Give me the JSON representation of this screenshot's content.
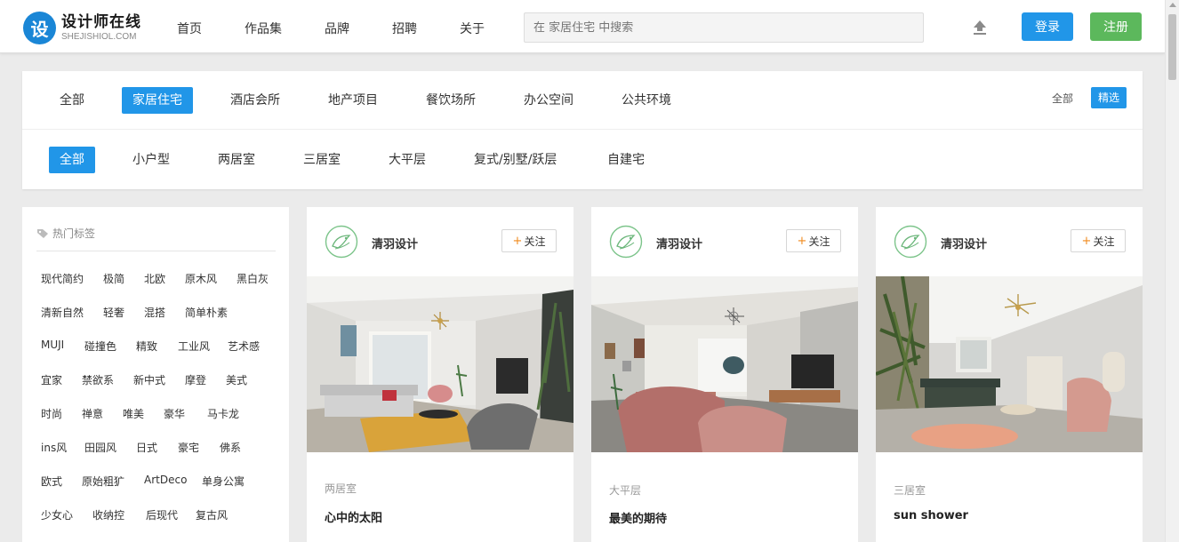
{
  "header": {
    "logo_glyph": "设",
    "logo_name": "设计师在线",
    "logo_domain": "SHEJISHIOL.COM",
    "nav": [
      "首页",
      "作品集",
      "品牌",
      "招聘",
      "关于"
    ],
    "search_placeholder": "在 家居住宅 中搜索",
    "upload_icon": "upload-icon",
    "login_label": "登录",
    "register_label": "注册",
    "accent_color": "#2196e8",
    "register_color": "#5cb85c"
  },
  "categories": {
    "main": [
      "全部",
      "家居住宅",
      "酒店会所",
      "地产项目",
      "餐饮场所",
      "办公空间",
      "公共环境"
    ],
    "main_active": "家居住宅",
    "filter_all": "全部",
    "filter_selected": "精选",
    "sub": [
      "全部",
      "小户型",
      "两居室",
      "三居室",
      "大平层",
      "复式/别墅/跃层",
      "自建宅"
    ],
    "sub_active": "全部"
  },
  "sidebar": {
    "title": "热门标签",
    "tag_rows": [
      [
        "现代简约",
        "极简",
        "北欧",
        "原木风",
        "黑白灰"
      ],
      [
        "清新自然",
        "轻奢",
        "混搭",
        "简单朴素"
      ],
      [
        "MUJI",
        "碰撞色",
        "精致",
        "工业风",
        "艺术感"
      ],
      [
        "宜家",
        "禁欲系",
        "新中式",
        "摩登",
        "美式"
      ],
      [
        "时尚",
        "禅意",
        "唯美",
        "豪华",
        "马卡龙"
      ],
      [
        "ins风",
        "田园风",
        "日式",
        "豪宅",
        "佛系"
      ],
      [
        "欧式",
        "原始粗犷",
        "ArtDeco",
        "单身公寓"
      ],
      [
        "少女心",
        "收纳控",
        "后现代",
        "复古风"
      ]
    ]
  },
  "cards": [
    {
      "author": "清羽设计",
      "follow": "关注",
      "category": "两居室",
      "title": "心中的太阳"
    },
    {
      "author": "清羽设计",
      "follow": "关注",
      "category": "大平层",
      "title": "最美的期待"
    },
    {
      "author": "清羽设计",
      "follow": "关注",
      "category": "三居室",
      "title": "sun shower"
    }
  ]
}
